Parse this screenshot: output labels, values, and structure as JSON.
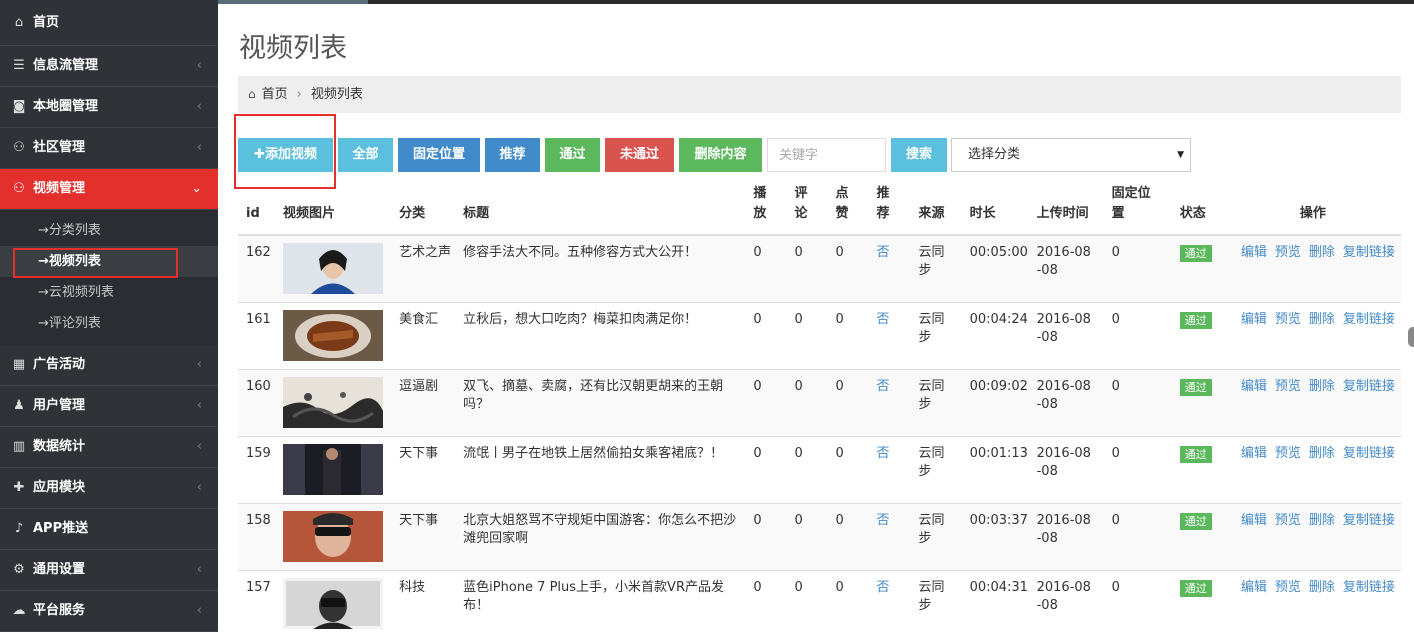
{
  "sidebar": {
    "items": [
      {
        "label": "首页",
        "icon": "home-icon",
        "glyph": "⌂"
      },
      {
        "label": "信息流管理",
        "icon": "list-icon",
        "glyph": "☰"
      },
      {
        "label": "本地圈管理",
        "icon": "camera-icon",
        "glyph": "◙"
      },
      {
        "label": "社区管理",
        "icon": "users-icon",
        "glyph": "⚇"
      },
      {
        "label": "视频管理",
        "icon": "users-icon",
        "glyph": "⚇"
      },
      {
        "label": "广告活动",
        "icon": "calendar-icon",
        "glyph": "▦"
      },
      {
        "label": "用户管理",
        "icon": "user-icon",
        "glyph": "♟"
      },
      {
        "label": "数据统计",
        "icon": "bar-chart-icon",
        "glyph": "▥"
      },
      {
        "label": "应用模块",
        "icon": "puzzle-icon",
        "glyph": "✚"
      },
      {
        "label": "APP推送",
        "icon": "bell-icon",
        "glyph": "♪"
      },
      {
        "label": "通用设置",
        "icon": "cogs-icon",
        "glyph": "⚙"
      },
      {
        "label": "平台服务",
        "icon": "cloud-icon",
        "glyph": "☁"
      }
    ],
    "chevron_collapsed": "‹",
    "chevron_expanded": "⌄",
    "video_sub": [
      "→分类列表",
      "→视频列表",
      "→云视频列表",
      "→评论列表"
    ]
  },
  "page": {
    "title": "视频列表",
    "breadcrumb": {
      "home": "首页",
      "separator": "›",
      "current": "视频列表"
    }
  },
  "toolbar": {
    "add": "✚添加视频",
    "all": "全部",
    "fixed": "固定位置",
    "recommend": "推荐",
    "pass": "通过",
    "fail": "未通过",
    "delete": "删除内容",
    "keyword_placeholder": "关键字",
    "search": "搜索",
    "category_select": "选择分类",
    "caret": "▼"
  },
  "table": {
    "headers": [
      "id",
      "视频图片",
      "分类",
      "标题",
      "播放",
      "评论",
      "点赞",
      "推荐",
      "来源",
      "时长",
      "上传时间",
      "固定位置",
      "状态",
      "操作"
    ],
    "ops": [
      "编辑",
      "预览",
      "删除",
      "复制链接"
    ],
    "rows": [
      {
        "id": "162",
        "category": "艺术之声",
        "title": "修容手法大不同。五种修容方式大公开！",
        "play": "0",
        "comments": "0",
        "likes": "0",
        "recommend": "否",
        "source": "云同步",
        "duration": "00:05:00",
        "uploaded": "2016-08-08",
        "fixed": "0",
        "status": "通过"
      },
      {
        "id": "161",
        "category": "美食汇",
        "title": "立秋后，想大口吃肉？梅菜扣肉满足你！",
        "play": "0",
        "comments": "0",
        "likes": "0",
        "recommend": "否",
        "source": "云同步",
        "duration": "00:04:24",
        "uploaded": "2016-08-08",
        "fixed": "0",
        "status": "通过"
      },
      {
        "id": "160",
        "category": "逗逼剧",
        "title": "双飞、摘墓、卖腐，还有比汉朝更胡来的王朝吗？",
        "play": "0",
        "comments": "0",
        "likes": "0",
        "recommend": "否",
        "source": "云同步",
        "duration": "00:09:02",
        "uploaded": "2016-08-08",
        "fixed": "0",
        "status": "通过"
      },
      {
        "id": "159",
        "category": "天下事",
        "title": "流氓丨男子在地铁上居然偷拍女乘客裙底？！",
        "play": "0",
        "comments": "0",
        "likes": "0",
        "recommend": "否",
        "source": "云同步",
        "duration": "00:01:13",
        "uploaded": "2016-08-08",
        "fixed": "0",
        "status": "通过"
      },
      {
        "id": "158",
        "category": "天下事",
        "title": "北京大姐怒骂不守规矩中国游客：你怎么不把沙滩兜回家啊",
        "play": "0",
        "comments": "0",
        "likes": "0",
        "recommend": "否",
        "source": "云同步",
        "duration": "00:03:37",
        "uploaded": "2016-08-08",
        "fixed": "0",
        "status": "通过"
      },
      {
        "id": "157",
        "category": "科技",
        "title": "蓝色iPhone 7 Plus上手，小米首款VR产品发布！",
        "play": "0",
        "comments": "0",
        "likes": "0",
        "recommend": "否",
        "source": "云同步",
        "duration": "00:04:31",
        "uploaded": "2016-08-08",
        "fixed": "0",
        "status": "通过"
      }
    ]
  }
}
